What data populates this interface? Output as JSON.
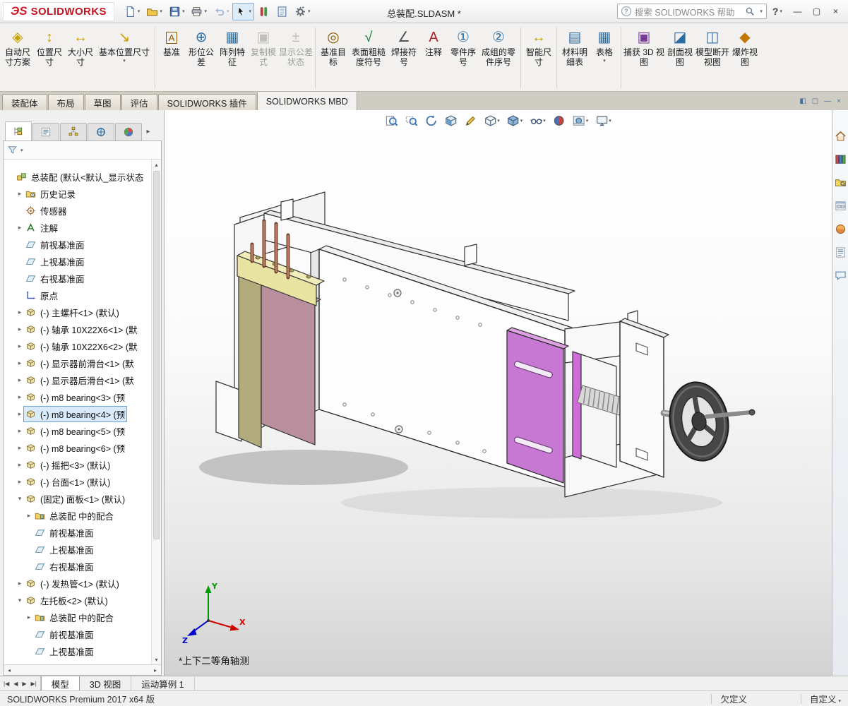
{
  "titlebar": {
    "brand_mark": "ЭS",
    "brand_name": "SOLIDWORKS",
    "title": "总装配.SLDASM *",
    "search_placeholder": "搜索 SOLIDWORKS 帮助",
    "help_label": "?",
    "quick_tools": [
      {
        "name": "new-document",
        "icon": "page",
        "caret": true
      },
      {
        "name": "open",
        "icon": "folder",
        "caret": true
      },
      {
        "name": "save",
        "icon": "disk",
        "caret": true
      },
      {
        "name": "print",
        "icon": "printer",
        "caret": true
      },
      {
        "name": "undo",
        "icon": "undo",
        "caret": true,
        "disabled": true
      },
      {
        "name": "select",
        "icon": "cursor",
        "caret": true,
        "pressed": true
      },
      {
        "name": "rebuild",
        "icon": "rebuild"
      },
      {
        "name": "file-properties",
        "icon": "sheet"
      },
      {
        "name": "options",
        "icon": "gear",
        "caret": true
      }
    ],
    "window_buttons": [
      {
        "name": "minimize-button",
        "glyph": "—"
      },
      {
        "name": "maximize-button",
        "glyph": "▢"
      },
      {
        "name": "close-button",
        "glyph": "×"
      }
    ]
  },
  "ribbon": {
    "items": [
      {
        "name": "auto-dimension-scheme",
        "label": "自动尺寸方案",
        "glyph": "◈",
        "color": "#c9a100",
        "w": 46
      },
      {
        "name": "location-dimension",
        "label": "位置尺寸",
        "glyph": "↕",
        "color": "#c9a100",
        "w": 44
      },
      {
        "name": "size-dimension",
        "label": "大小尺寸",
        "glyph": "↔",
        "color": "#c9a100",
        "w": 44
      },
      {
        "name": "basic-location-dimension",
        "label": "基本位置尺寸",
        "glyph": "↘",
        "color": "#c9a100",
        "w": 80,
        "caret": true
      },
      {
        "sep": true
      },
      {
        "name": "datum",
        "label": "基准",
        "glyph": "A",
        "color": "#8a5a00",
        "boxed": true,
        "w": 40
      },
      {
        "name": "geometric-tolerance",
        "label": "形位公差",
        "glyph": "⊕",
        "color": "#2e6da4",
        "w": 44
      },
      {
        "name": "pattern-feature",
        "label": "阵列特征",
        "glyph": "▦",
        "color": "#2e6da4",
        "w": 44
      },
      {
        "name": "copy-scheme",
        "label": "复制模式",
        "glyph": "▣",
        "color": "#777777",
        "w": 44,
        "disabled": true
      },
      {
        "name": "show-tolerance-status",
        "label": "显示公差状态",
        "glyph": "±",
        "color": "#777777",
        "w": 48,
        "disabled": true
      },
      {
        "sep": true
      },
      {
        "name": "datum-target",
        "label": "基准目标",
        "glyph": "◎",
        "color": "#8a5a00",
        "w": 44
      },
      {
        "name": "surface-finish-symbol",
        "label": "表面粗糙度符号",
        "glyph": "√",
        "color": "#1a7a3a",
        "w": 56
      },
      {
        "name": "weld-symbol",
        "label": "焊接符号",
        "glyph": "∠",
        "color": "#555555",
        "w": 44
      },
      {
        "name": "note",
        "label": "注释",
        "glyph": "A",
        "color": "#b02020",
        "w": 40
      },
      {
        "name": "balloon",
        "label": "零件序号",
        "glyph": "①",
        "color": "#2e6da4",
        "w": 44
      },
      {
        "name": "auto-balloon",
        "label": "成组的零件序号",
        "glyph": "②",
        "color": "#2e6da4",
        "w": 56
      },
      {
        "sep": true
      },
      {
        "name": "smart-dimension",
        "label": "智能尺寸",
        "glyph": "↔",
        "color": "#c9a100",
        "w": 44
      },
      {
        "sep": true
      },
      {
        "name": "bill-of-materials",
        "label": "材料明细表",
        "glyph": "▤",
        "color": "#2e6da4",
        "w": 44
      },
      {
        "name": "tables",
        "label": "表格",
        "glyph": "▦",
        "color": "#2e6da4",
        "w": 40,
        "caret": true
      },
      {
        "sep": true
      },
      {
        "name": "capture-3d-view",
        "label": "捕获 3D 视图",
        "glyph": "▣",
        "color": "#7a3a9a",
        "w": 58
      },
      {
        "name": "section-view",
        "label": "剖面视图",
        "glyph": "◪",
        "color": "#2e6da4",
        "w": 44
      },
      {
        "name": "model-break-view",
        "label": "模型断开视图",
        "glyph": "◫",
        "color": "#2e6da4",
        "w": 48
      },
      {
        "name": "exploded-view",
        "label": "爆炸视图",
        "glyph": "◆",
        "color": "#c07800",
        "w": 44
      }
    ]
  },
  "command_tabs": {
    "tabs": [
      {
        "name": "tab-assembly",
        "label": "装配体"
      },
      {
        "name": "tab-layout",
        "label": "布局"
      },
      {
        "name": "tab-sketch",
        "label": "草图"
      },
      {
        "name": "tab-evaluate",
        "label": "评估"
      },
      {
        "name": "tab-solidworks-addins",
        "label": "SOLIDWORKS 插件"
      },
      {
        "name": "tab-solidworks-mbd",
        "label": "SOLIDWORKS MBD",
        "active": true
      }
    ],
    "doc_controls": [
      {
        "name": "dock-panel",
        "glyph": "◧"
      },
      {
        "name": "restore-document",
        "glyph": "▢"
      },
      {
        "name": "minimize-document",
        "glyph": "—"
      },
      {
        "name": "close-document",
        "glyph": "×"
      }
    ]
  },
  "feature_panel": {
    "tabs": [
      {
        "name": "featuremanager-design-tree-tab",
        "icon": "pmtree",
        "active": true
      },
      {
        "name": "propertymanager-tab",
        "icon": "pmprop"
      },
      {
        "name": "configurationmanager-tab",
        "icon": "pmconfig"
      },
      {
        "name": "dimxpertmanager-tab",
        "icon": "pmdimx"
      },
      {
        "name": "displaymanager-tab",
        "icon": "pmdisplay"
      }
    ],
    "tree": [
      {
        "name": "assembly-root",
        "icon": "assembly",
        "label": "总装配 (默认<默认_显示状态",
        "level": 0,
        "arrow": ""
      },
      {
        "name": "history-folder",
        "icon": "history",
        "label": "历史记录",
        "level": 1,
        "arrow": "r"
      },
      {
        "name": "sensors-folder",
        "icon": "sensor",
        "label": "传感器",
        "level": 1,
        "arrow": ""
      },
      {
        "name": "annotations-folder",
        "icon": "ann",
        "label": "注解",
        "level": 1,
        "arrow": "r"
      },
      {
        "name": "front-plane",
        "icon": "plane",
        "label": "前视基准面",
        "level": 1,
        "arrow": ""
      },
      {
        "name": "top-plane",
        "icon": "plane",
        "label": "上视基准面",
        "level": 1,
        "arrow": ""
      },
      {
        "name": "right-plane",
        "icon": "plane",
        "label": "右视基准面",
        "level": 1,
        "arrow": ""
      },
      {
        "name": "origin",
        "icon": "origin",
        "label": "原点",
        "level": 1,
        "arrow": ""
      },
      {
        "name": "component-main-screw",
        "icon": "part",
        "label": "(-) 主螺杆<1> (默认)",
        "level": 1,
        "arrow": "r"
      },
      {
        "name": "component-bearing-1",
        "icon": "part",
        "label": "(-) 轴承 10X22X6<1> (默",
        "level": 1,
        "arrow": "r"
      },
      {
        "name": "component-bearing-2",
        "icon": "part",
        "label": "(-) 轴承 10X22X6<2> (默",
        "level": 1,
        "arrow": "r"
      },
      {
        "name": "component-front-slide",
        "icon": "part",
        "label": "(-) 显示器前滑台<1> (默",
        "level": 1,
        "arrow": "r"
      },
      {
        "name": "component-rear-slide",
        "icon": "part",
        "label": "(-) 显示器后滑台<1> (默",
        "level": 1,
        "arrow": "r"
      },
      {
        "name": "component-m8-bearing-3",
        "icon": "part",
        "label": "(-) m8  bearing<3> (预",
        "level": 1,
        "arrow": "r"
      },
      {
        "name": "component-m8-bearing-4",
        "icon": "part",
        "label": "(-) m8  bearing<4> (预",
        "level": 1,
        "arrow": "r",
        "selected": true
      },
      {
        "name": "component-m8-bearing-5",
        "icon": "part",
        "label": "(-) m8  bearing<5> (预",
        "level": 1,
        "arrow": "r"
      },
      {
        "name": "component-m8-bearing-6",
        "icon": "part",
        "label": "(-) m8  bearing<6> (预",
        "level": 1,
        "arrow": "r"
      },
      {
        "name": "component-handle",
        "icon": "part",
        "label": "(-) 摇把<3> (默认)",
        "level": 1,
        "arrow": "r"
      },
      {
        "name": "component-table-top",
        "icon": "part",
        "label": "(-) 台面<1> (默认)",
        "level": 1,
        "arrow": "r"
      },
      {
        "name": "component-panel",
        "icon": "part",
        "label": "(固定) 面板<1> (默认)",
        "level": 1,
        "arrow": "d"
      },
      {
        "name": "mates-folder",
        "icon": "mates",
        "label": "总装配 中的配合",
        "level": 2,
        "arrow": "r"
      },
      {
        "name": "front-plane",
        "icon": "plane",
        "label": "前视基准面",
        "level": 2,
        "arrow": ""
      },
      {
        "name": "top-plane",
        "icon": "plane",
        "label": "上视基准面",
        "level": 2,
        "arrow": ""
      },
      {
        "name": "right-plane",
        "icon": "plane",
        "label": "右视基准面",
        "level": 2,
        "arrow": ""
      },
      {
        "name": "component-heating-tube",
        "icon": "part",
        "label": "(-) 发热管<1> (默认)",
        "level": 1,
        "arrow": "r"
      },
      {
        "name": "component-left-bracket",
        "icon": "part",
        "label": "左托板<2> (默认)",
        "level": 1,
        "arrow": "d"
      },
      {
        "name": "mates-folder",
        "icon": "mates",
        "label": "总装配 中的配合",
        "level": 2,
        "arrow": "r"
      },
      {
        "name": "front-plane",
        "icon": "plane",
        "label": "前视基准面",
        "level": 2,
        "arrow": ""
      },
      {
        "name": "top-plane",
        "icon": "plane",
        "label": "上视基准面",
        "level": 2,
        "arrow": ""
      }
    ]
  },
  "graphics": {
    "headsup": [
      {
        "name": "zoom-to-fit",
        "icon": "zoomfit"
      },
      {
        "name": "zoom-to-area",
        "icon": "zoomarea"
      },
      {
        "name": "previous-view",
        "icon": "prevview"
      },
      {
        "name": "section-view-toggle",
        "icon": "section"
      },
      {
        "name": "annotation-view",
        "icon": "pencil"
      },
      {
        "name": "view-orientation",
        "icon": "orientcube",
        "caret": true
      },
      {
        "name": "display-style",
        "icon": "shadedcube",
        "caret": true
      },
      {
        "name": "hide-show-items",
        "icon": "glasses",
        "caret": true
      },
      {
        "name": "edit-appearance",
        "icon": "ballrb"
      },
      {
        "name": "apply-scene",
        "icon": "scenesphere",
        "caret": true
      },
      {
        "name": "view-settings",
        "icon": "monitor",
        "caret": true
      }
    ],
    "view_label": "*上下二等角轴测",
    "axis_x": "X",
    "axis_y": "Y",
    "axis_z": "Z"
  },
  "taskpane": {
    "items": [
      {
        "name": "solidworks-resources",
        "icon": "home"
      },
      {
        "name": "design-library",
        "icon": "library"
      },
      {
        "name": "file-explorer",
        "icon": "folderx"
      },
      {
        "name": "view-palette",
        "icon": "palette"
      },
      {
        "name": "appearances-scenes",
        "icon": "sphere"
      },
      {
        "name": "custom-properties",
        "icon": "props"
      },
      {
        "name": "solidworks-forum",
        "icon": "forum"
      }
    ]
  },
  "bottom_bar": {
    "nav": [
      "|◀",
      "◀",
      "▶",
      "▶|"
    ],
    "tabs": [
      {
        "name": "tab-model",
        "label": "模型",
        "active": true
      },
      {
        "name": "tab-3d-views",
        "label": "3D 视图"
      },
      {
        "name": "tab-motion-study-1",
        "label": "运动算例 1"
      }
    ]
  },
  "statusbar": {
    "product": "SOLIDWORKS Premium 2017 x64 版",
    "state": "欠定义",
    "custom": "自定义"
  }
}
